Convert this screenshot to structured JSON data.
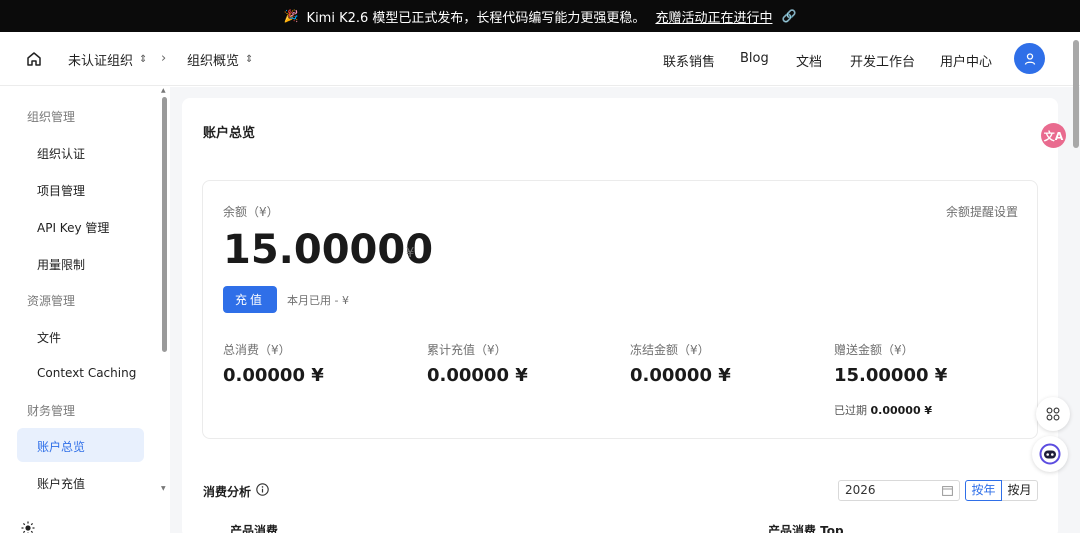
{
  "announcement": {
    "icon": "party-popper-icon",
    "text": "Kimi K2.6 模型已正式发布，长程代码编写能力更强更稳。",
    "link": "充赠活动正在进行中"
  },
  "header": {
    "org": "未认证组织",
    "section": "组织概览",
    "separator": "›",
    "nav": [
      "联系销售",
      "Blog",
      "文档",
      "开发工作台",
      "用户中心"
    ]
  },
  "sidebar": {
    "groups": [
      {
        "label": "组织管理",
        "items": [
          "组织认证",
          "项目管理",
          "API Key 管理",
          "用量限制"
        ]
      },
      {
        "label": "资源管理",
        "items": [
          "文件",
          "Context Caching"
        ]
      },
      {
        "label": "财务管理",
        "items": [
          "账户总览",
          "账户充值"
        ]
      }
    ],
    "active_item": "账户总览"
  },
  "main": {
    "title": "账户总览",
    "balance": {
      "label": "余额（¥）",
      "amount": "15.00000",
      "unit": "¥",
      "reminder": "余额提醒设置",
      "recharge": "充值",
      "month_used": "本月已用 - ¥"
    },
    "stats": [
      {
        "label": "总消费（¥）",
        "value": "0.00000 ¥"
      },
      {
        "label": "累计充值（¥）",
        "value": "0.00000 ¥"
      },
      {
        "label": "冻结金额（¥）",
        "value": "0.00000 ¥"
      },
      {
        "label": "赠送金额（¥）",
        "value": "15.00000 ¥"
      }
    ],
    "expired": {
      "label": "已过期",
      "value": "0.00000 ¥"
    },
    "analysis": {
      "title": "消费分析",
      "year": "2026",
      "by_year": "按年",
      "by_month": "按月",
      "product_usage": "产品消费",
      "product_top": "产品消费 Top"
    }
  },
  "colors": {
    "accent": "#2f6fe8",
    "announce_bg": "#0b0b0b",
    "active_bg": "#e8f0fd"
  }
}
